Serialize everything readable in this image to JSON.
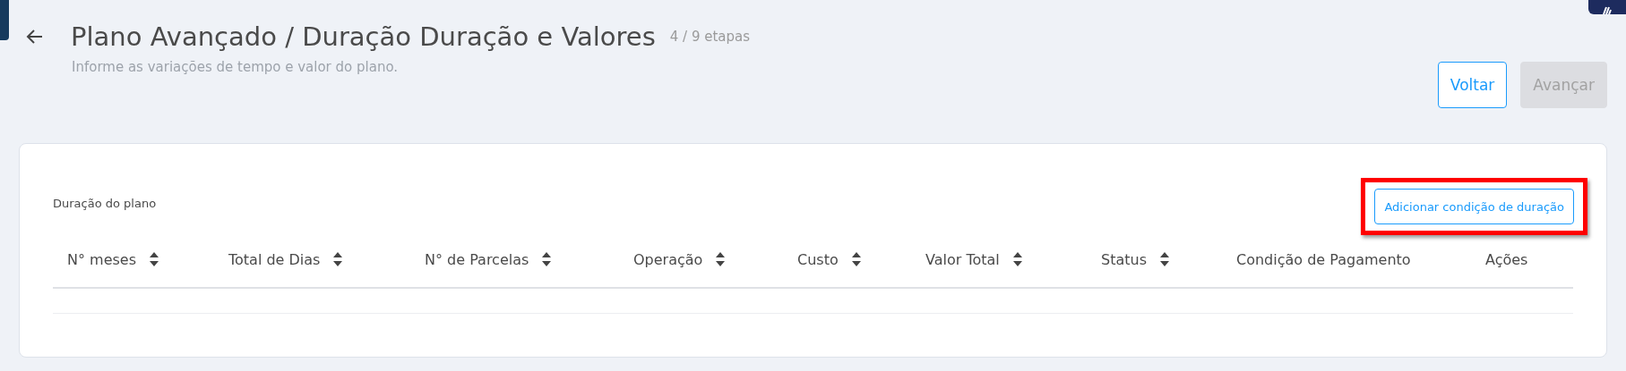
{
  "header": {
    "title": "Plano Avançado / Duração Duração e Valores",
    "steps": "4 / 9 etapas",
    "subtitle": "Informe as variações de tempo e valor do plano."
  },
  "buttons": [
    {
      "label": "Voltar",
      "disabled": false
    },
    {
      "label": "Avançar",
      "disabled": true
    }
  ],
  "section": {
    "title": "Duração do plano",
    "add_button": {
      "label": "Adicionar condição de duração",
      "highlighted": true
    }
  },
  "table": {
    "columns": [
      {
        "label": "N° meses",
        "sortable": true
      },
      {
        "label": "Total de Dias",
        "sortable": true
      },
      {
        "label": "N° de Parcelas",
        "sortable": true
      },
      {
        "label": "Operação",
        "sortable": true
      },
      {
        "label": "Custo",
        "sortable": true
      },
      {
        "label": "Valor Total",
        "sortable": true
      },
      {
        "label": "Status",
        "sortable": true
      },
      {
        "label": "Condição de Pagamento",
        "sortable": false
      },
      {
        "label": "Ações",
        "sortable": false
      }
    ]
  }
}
